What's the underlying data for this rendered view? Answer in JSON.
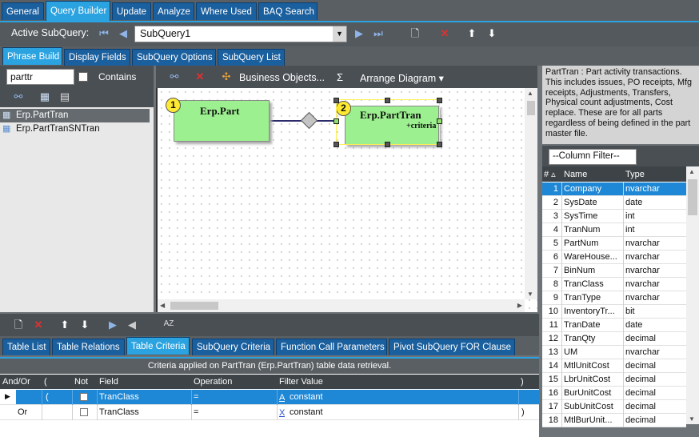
{
  "top_tabs": [
    "General",
    "Query Builder",
    "Update",
    "Analyze",
    "Where Used",
    "BAQ Search"
  ],
  "active_subquery": {
    "label": "Active SubQuery:",
    "value": "SubQuery1"
  },
  "sub_tabs": [
    "Phrase Build",
    "Display Fields",
    "SubQuery Options",
    "SubQuery List"
  ],
  "left": {
    "search_value": "parttr",
    "contains_label": "Contains",
    "tables": [
      "Erp.PartTran",
      "Erp.PartTranSNTran"
    ]
  },
  "diagram_toolbar": {
    "business_objects": "Business Objects...",
    "sigma": "Σ",
    "arrange": "Arrange Diagram"
  },
  "diagram": {
    "node1": {
      "num": "1",
      "title": "Erp.Part"
    },
    "node2": {
      "num": "2",
      "title": "Erp.PartTran",
      "sub": "+criteria"
    }
  },
  "description": "PartTran : Part activity transactions. This includes issues, PO receipts, Mfg receipts, Adjustments, Transfers, Physical count    adjustments, Cost replace. These are for all parts regardless of being defined in the part master file.",
  "column_filter": "--Column Filter--",
  "columns_header": {
    "num": "#",
    "name": "Name",
    "type": "Type"
  },
  "columns": [
    {
      "n": "1",
      "name": "Company",
      "type": "nvarchar"
    },
    {
      "n": "2",
      "name": "SysDate",
      "type": "date"
    },
    {
      "n": "3",
      "name": "SysTime",
      "type": "int"
    },
    {
      "n": "4",
      "name": "TranNum",
      "type": "int"
    },
    {
      "n": "5",
      "name": "PartNum",
      "type": "nvarchar"
    },
    {
      "n": "6",
      "name": "WareHouse...",
      "type": "nvarchar"
    },
    {
      "n": "7",
      "name": "BinNum",
      "type": "nvarchar"
    },
    {
      "n": "8",
      "name": "TranClass",
      "type": "nvarchar"
    },
    {
      "n": "9",
      "name": "TranType",
      "type": "nvarchar"
    },
    {
      "n": "10",
      "name": "InventoryTr...",
      "type": "bit"
    },
    {
      "n": "11",
      "name": "TranDate",
      "type": "date"
    },
    {
      "n": "12",
      "name": "TranQty",
      "type": "decimal"
    },
    {
      "n": "13",
      "name": "UM",
      "type": "nvarchar"
    },
    {
      "n": "14",
      "name": "MtlUnitCost",
      "type": "decimal"
    },
    {
      "n": "15",
      "name": "LbrUnitCost",
      "type": "decimal"
    },
    {
      "n": "16",
      "name": "BurUnitCost",
      "type": "decimal"
    },
    {
      "n": "17",
      "name": "SubUnitCost",
      "type": "decimal"
    },
    {
      "n": "18",
      "name": "MtlBurUnit...",
      "type": "decimal"
    }
  ],
  "bottom_tabs": [
    "Table List",
    "Table Relations",
    "Table Criteria",
    "SubQuery Criteria",
    "Function Call Parameters",
    "Pivot SubQuery FOR Clause"
  ],
  "criteria_caption": "Criteria applied on PartTran (Erp.PartTran)  table data retrieval.",
  "criteria_header": {
    "andor": "And/Or",
    "paren_open": "(",
    "not": "Not",
    "field": "Field",
    "operation": "Operation",
    "filter": "Filter Value",
    "paren_close": ")"
  },
  "criteria_rows": [
    {
      "andor": "",
      "paren_open": "(",
      "field": "TranClass",
      "operation": "=",
      "filter_icon": "A",
      "filter": "constant",
      "paren_close": ""
    },
    {
      "andor": "Or",
      "paren_open": "",
      "field": "TranClass",
      "operation": "=",
      "filter_icon": "X",
      "filter": "constant",
      "paren_close": ")"
    }
  ]
}
